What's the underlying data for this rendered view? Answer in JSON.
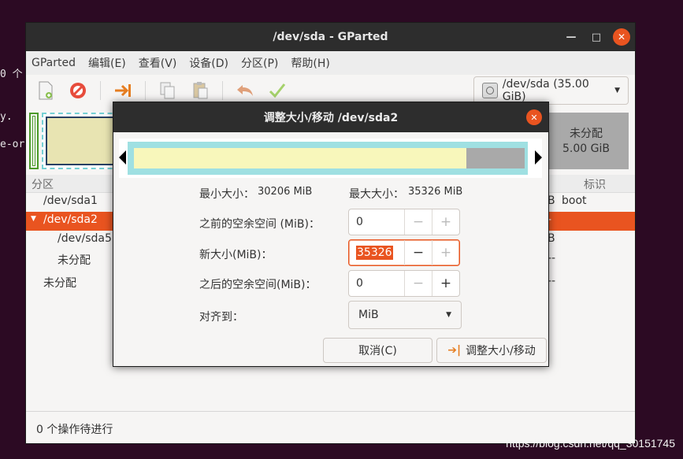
{
  "terminal_fragments": [
    "0 个",
    "y.",
    "e-or"
  ],
  "window": {
    "title": "/dev/sda - GParted",
    "controls": {
      "minimize": "—",
      "maximize": "□",
      "close": "✕"
    }
  },
  "menu": [
    "GParted",
    "编辑(E)",
    "查看(V)",
    "设备(D)",
    "分区(P)",
    "帮助(H)"
  ],
  "device_selector": {
    "label": "/dev/sda (35.00 GiB)"
  },
  "graph": {
    "unallocated_label": "未分配",
    "unallocated_size": "5.00 GiB"
  },
  "list": {
    "headers": {
      "partition": "分区",
      "flags": "标识"
    },
    "rows": [
      {
        "name": "/dev/sda1",
        "right": "B",
        "flag": "boot",
        "selected": false
      },
      {
        "name": "/dev/sda2",
        "right": "-",
        "flag": "",
        "selected": true
      },
      {
        "name": "/dev/sda5",
        "right": "B",
        "flag": "",
        "selected": false
      },
      {
        "name": "未分配",
        "right": "--",
        "flag": "",
        "selected": false
      },
      {
        "name": "未分配",
        "right": "--",
        "flag": "",
        "selected": false
      }
    ]
  },
  "status": "0 个操作待进行",
  "dialog": {
    "title": "调整大小/移动 /dev/sda2",
    "min_label": "最小大小：",
    "min_value": "30206 MiB",
    "max_label": "最大大小：",
    "max_value": "35326 MiB",
    "used_fraction": 0.85,
    "fields": [
      {
        "label": "之前的空余空间 (MiB)：",
        "value": "0"
      },
      {
        "label": "新大小(MiB)：",
        "value": "35326"
      },
      {
        "label": "之后的空余空间(MiB)：",
        "value": "0"
      }
    ],
    "align_label": "对齐到：",
    "align_value": "MiB",
    "cancel": "取消(C)",
    "apply": "调整大小/移动"
  },
  "watermark": "https://blog.csdn.net/qq_30151745"
}
